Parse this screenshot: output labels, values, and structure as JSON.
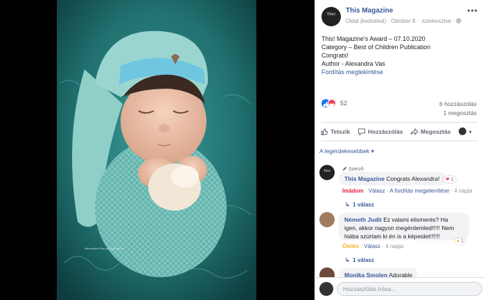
{
  "post": {
    "page_name": "This Magazine",
    "meta": "Oldal (kedveled) · Október 8. · szerkesztve ·",
    "avatar_text": "This!",
    "lines": [
      "This! Magazine's Award – 07.10.2020",
      "Category – Best of Children Publication",
      "Congrats!",
      "Author - Alexandra Vas"
    ],
    "see_translation": "Fordítás megtekintése",
    "reaction_count": "52",
    "comments_count": "6 hozzászólás",
    "shares_count": "1 megosztás"
  },
  "actions": {
    "like": "Tetszik",
    "comment": "Hozzászólás",
    "share": "Megosztás"
  },
  "sort_label": "A legérdekesebbek ▾",
  "comments": [
    {
      "author_badge": "Szerző",
      "name": "This Magazine",
      "text": "Congrats Alexandra!",
      "reaction_label": "Imádom",
      "reply": "Válasz",
      "translation": "A fordítás megjelenítése",
      "time": "4 napja",
      "reaction_count": "1",
      "replies": "1 válasz"
    },
    {
      "name": "Németh Judit",
      "text_lines": [
        "Ez valami elismerés? Ha",
        "igen, akkor nagyon megérdemled!!!!! Nem",
        "hiába szúrtam ki én is a képeidet!!!!!!"
      ],
      "reaction_label": "Ölelés",
      "reply": "Válasz",
      "time": "4 napja",
      "reaction_count": "1",
      "replies": "1 válasz"
    },
    {
      "name": "Monika Smolen",
      "text": "Adorable"
    }
  ],
  "composer": {
    "placeholder": "Hozzászólás írása..."
  },
  "photo": {
    "watermark": "Alexandra Vas photography"
  },
  "colors": {
    "link": "#385898",
    "teal": "#2e8b8b",
    "like": "#1877f2",
    "love": "#f33e58"
  }
}
